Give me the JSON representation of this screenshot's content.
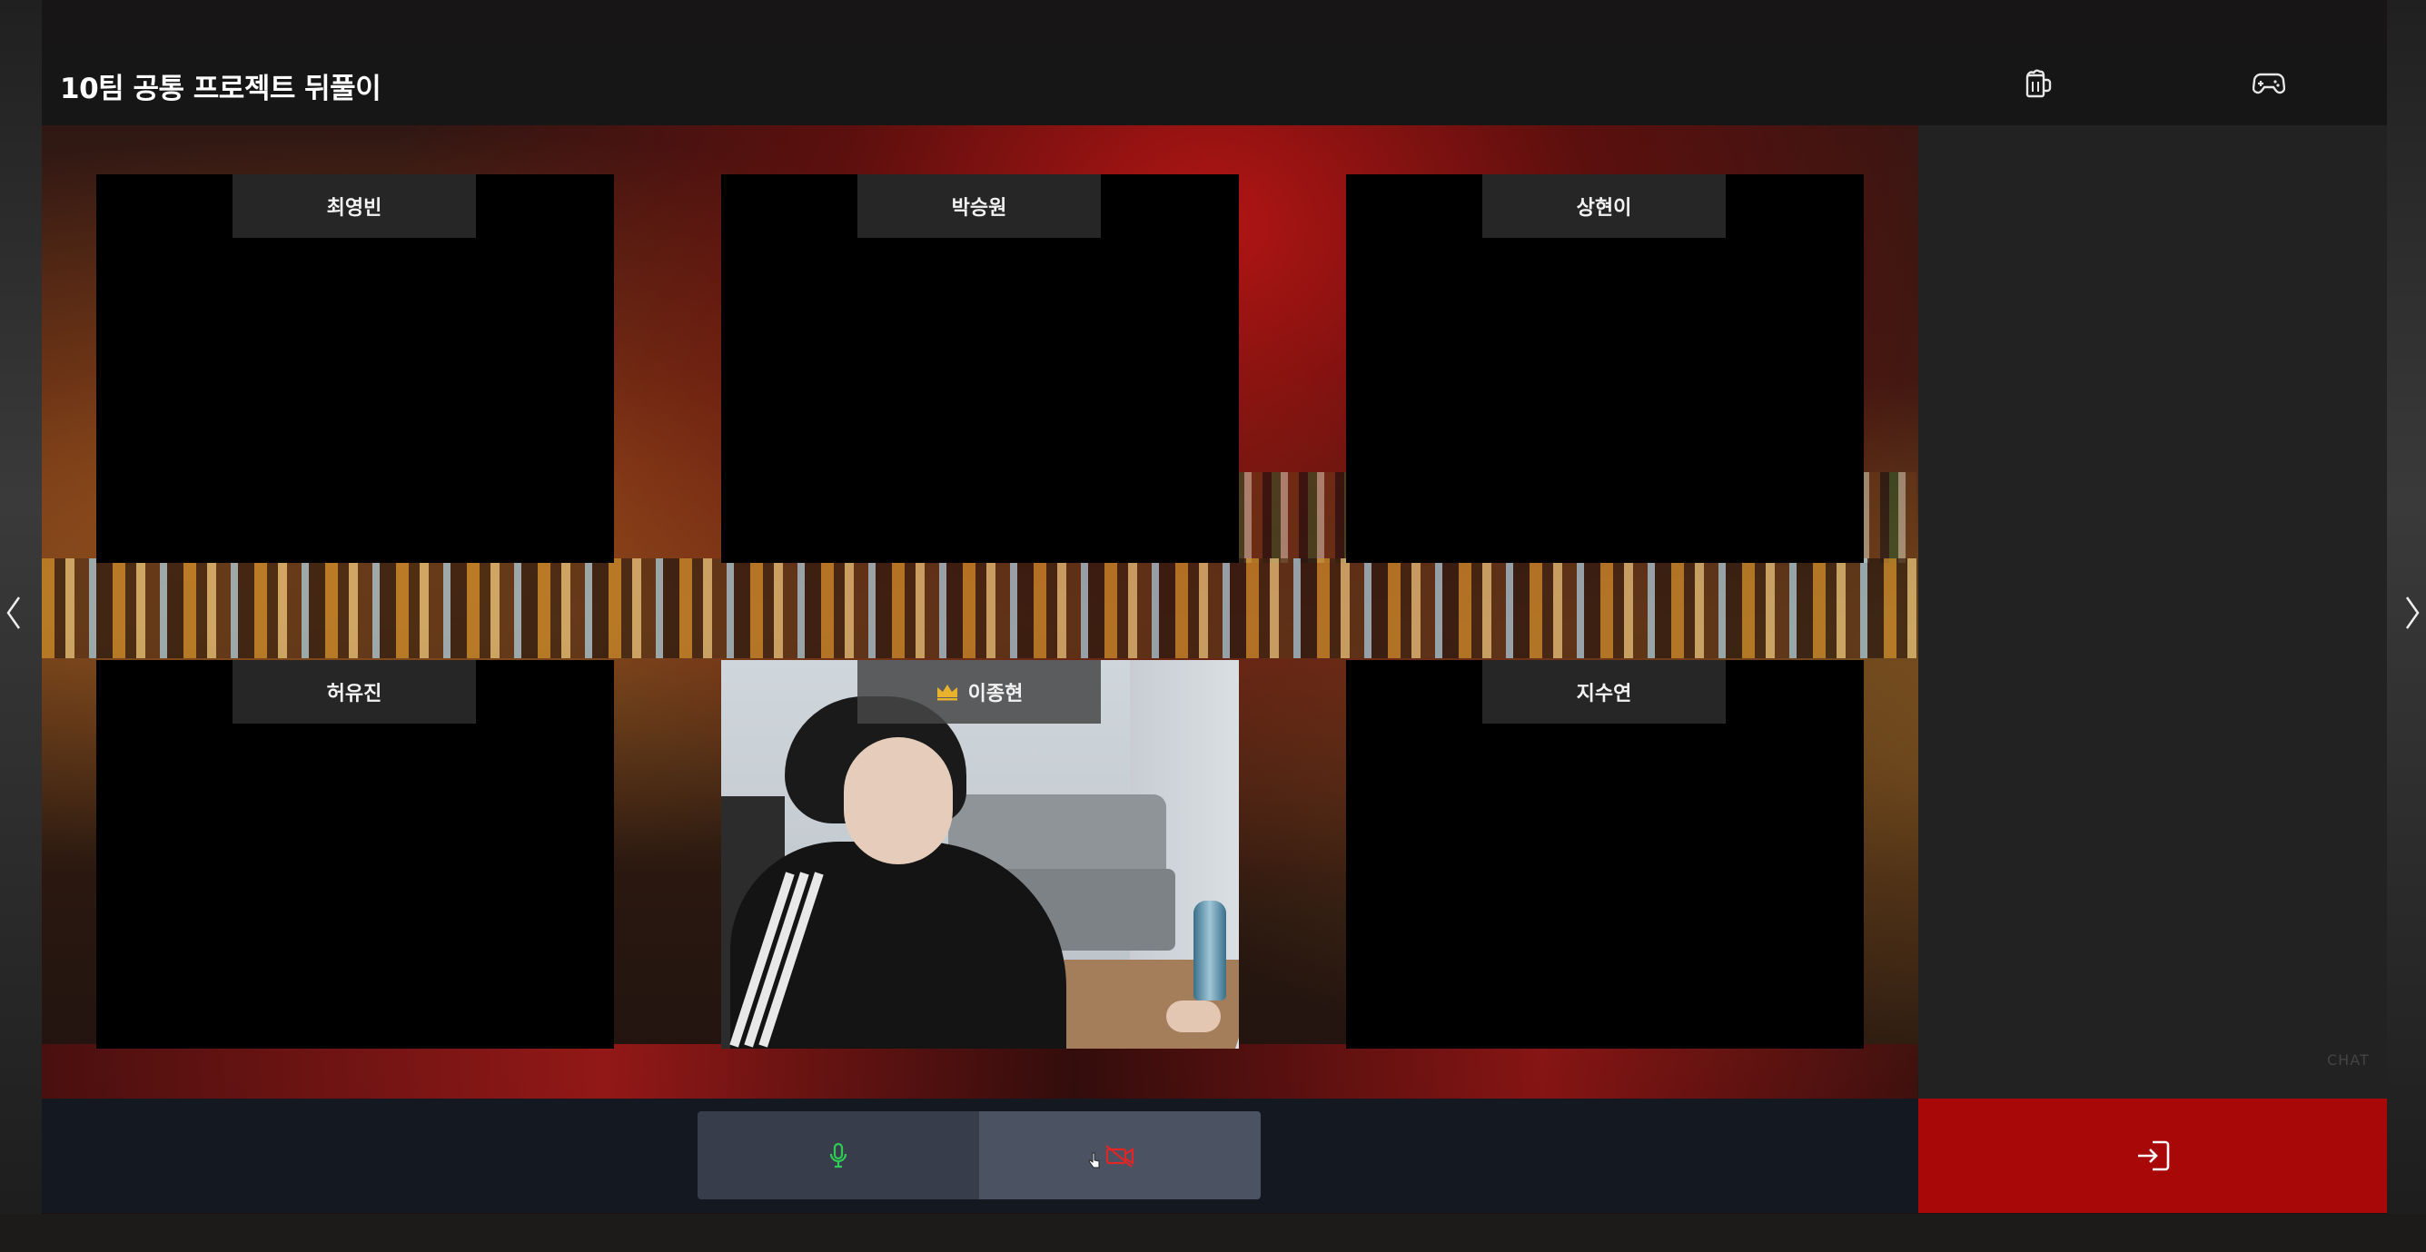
{
  "header": {
    "room_title": "10팀 공통 프로젝트 뒤풀이",
    "icons": [
      "beer-mug-icon",
      "gamepad-icon"
    ]
  },
  "participants": [
    {
      "name": "최영빈",
      "is_host": false,
      "camera_on": false
    },
    {
      "name": "박승원",
      "is_host": false,
      "camera_on": false
    },
    {
      "name": "상현이",
      "is_host": false,
      "camera_on": false
    },
    {
      "name": "허유진",
      "is_host": false,
      "camera_on": false
    },
    {
      "name": "이종현",
      "is_host": true,
      "camera_on": true
    },
    {
      "name": "지수연",
      "is_host": false,
      "camera_on": false
    }
  ],
  "side_panel": {
    "chat_label": "CHAT"
  },
  "controls": {
    "mic_icon": "microphone-icon",
    "camera_icon": "camera-off-icon",
    "leave_icon": "exit-icon"
  },
  "colors": {
    "mic_on": "#2fcc55",
    "camera_off": "#e02626",
    "leave_button": "#a80808",
    "host_crown": "#e9b22c"
  }
}
